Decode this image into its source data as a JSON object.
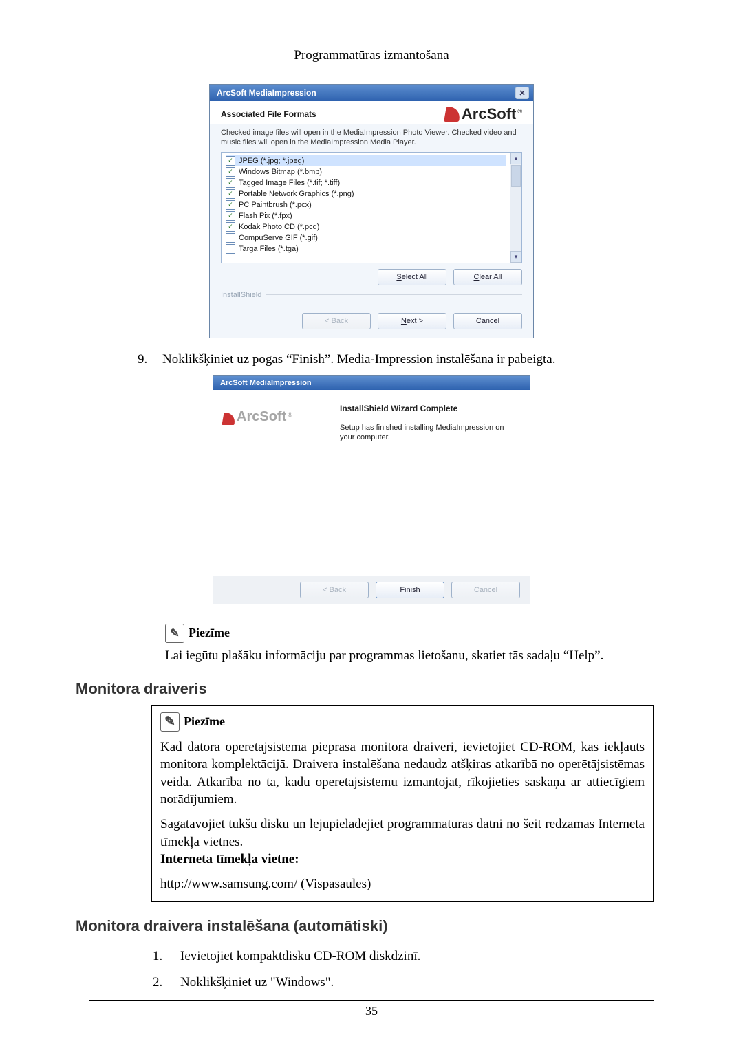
{
  "header": {
    "title": "Programmatūras izmantošana"
  },
  "dialog1": {
    "title": "ArcSoft MediaImpression",
    "heading": "Associated File Formats",
    "logo_text": "ArcSoft",
    "desc": "Checked image files will open in the MediaImpression Photo Viewer. Checked video and music files will open in the MediaImpression Media Player.",
    "formats": [
      {
        "label": "JPEG (*.jpg; *.jpeg)",
        "checked": true,
        "sel": true
      },
      {
        "label": "Windows Bitmap (*.bmp)",
        "checked": true
      },
      {
        "label": "Tagged Image Files (*.tif; *.tiff)",
        "checked": true
      },
      {
        "label": "Portable Network Graphics (*.png)",
        "checked": true
      },
      {
        "label": "PC Paintbrush (*.pcx)",
        "checked": true
      },
      {
        "label": "Flash Pix (*.fpx)",
        "checked": true
      },
      {
        "label": "Kodak Photo CD (*.pcd)",
        "checked": true
      },
      {
        "label": "CompuServe GIF (*.gif)",
        "checked": false
      },
      {
        "label": "Targa Files (*.tga)",
        "checked": false
      }
    ],
    "select_all": "Select All",
    "clear_all": "Clear All",
    "install_shield": "InstallShield",
    "back": "< Back",
    "next": "Next >",
    "cancel": "Cancel"
  },
  "step9": {
    "num": "9.",
    "text": "Noklikšķiniet uz pogas “Finish”. Media-Impression instalēšana ir pabeigta."
  },
  "dialog2": {
    "title": "ArcSoft MediaImpression",
    "logo_text": "ArcSoft",
    "heading": "InstallShield Wizard Complete",
    "body": "Setup has finished installing MediaImpression on your computer.",
    "back": "< Back",
    "finish": "Finish",
    "cancel": "Cancel"
  },
  "note1": {
    "label": "Piezīme",
    "text": "Lai iegūtu plašāku informāciju par programmas lietošanu, skatiet tās sadaļu “Help”."
  },
  "section_monitor_driver": "Monitora draiveris",
  "note_box": {
    "label": "Piezīme",
    "para1": "Kad datora operētājsistēma pieprasa monitora draiveri, ievietojiet CD-ROM, kas iekļauts monitora komplektācijā. Draivera instalēšana nedaudz atšķiras atkarībā no operētājsistēmas veida. Atkarībā no tā, kādu operētājsistēmu izmantojat, rīkojieties saskaņā ar attiecīgiem norādījumiem.",
    "para2": "Sagatavojiet tukšu disku un lejupielādējiet programmatūras datni no šeit redzamās Interneta tīmekļa vietnes.",
    "bold_line": "Interneta tīmekļa vietne:",
    "url_line": "http://www.samsung.com/ (Vispasaules)"
  },
  "section_install_auto": "Monitora draivera instalēšana (automātiski)",
  "install_steps": [
    {
      "n": "1.",
      "t": "Ievietojiet kompaktdisku CD-ROM diskdzinī."
    },
    {
      "n": "2.",
      "t": "Noklikšķiniet uz \"Windows\"."
    }
  ],
  "page_number": "35"
}
